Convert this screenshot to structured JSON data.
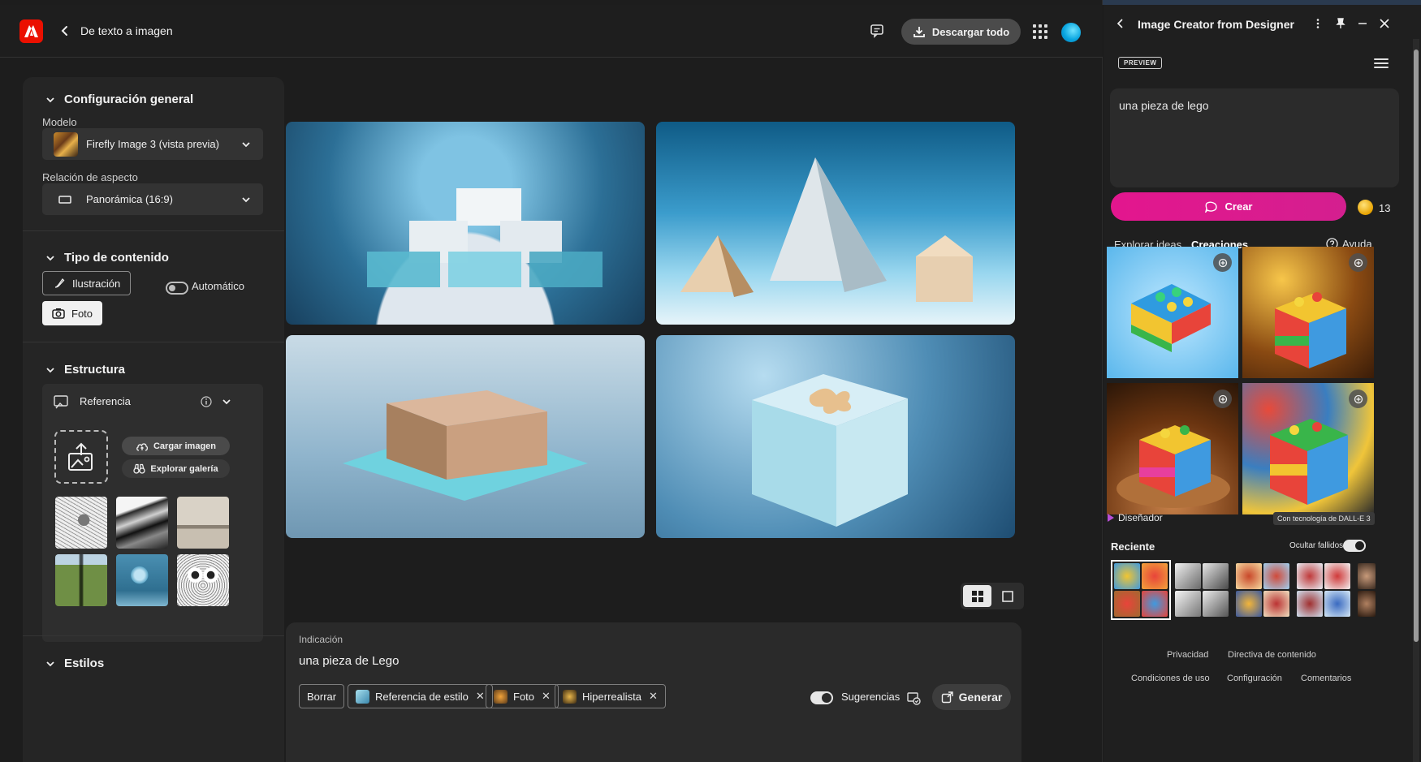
{
  "header": {
    "title": "De texto a imagen",
    "download_label": "Descargar todo"
  },
  "left_panel": {
    "general": {
      "title": "Configuración general",
      "model_label": "Modelo",
      "model_value": "Firefly Image 3 (vista previa)",
      "aspect_label": "Relación de aspecto",
      "aspect_value": "Panorámica (16:9)"
    },
    "content_type": {
      "title": "Tipo de contenido",
      "options": [
        "Ilustración",
        "Foto"
      ],
      "selected": "Foto",
      "auto_label": "Automático"
    },
    "structure": {
      "title": "Estructura",
      "reference_label": "Referencia",
      "upload_label": "Cargar imagen",
      "gallery_label": "Explorar galería"
    },
    "styles": {
      "title": "Estilos"
    }
  },
  "prompt": {
    "label": "Indicación",
    "text": "una pieza de Lego",
    "clear_label": "Borrar",
    "tags": [
      "Referencia de estilo",
      "Foto",
      "Hiperrealista"
    ],
    "suggestions_label": "Sugerencias",
    "generate_label": "Generar"
  },
  "side_panel": {
    "title": "Image Creator from Designer",
    "badge": "PREVIEW",
    "prompt_text": "una pieza de lego",
    "create_label": "Crear",
    "coins": "13",
    "tabs": [
      "Explorar ideas",
      "Creaciones"
    ],
    "active_tab": "Creaciones",
    "help_label": "Ayuda",
    "designer_label": "Diseñador",
    "dalle_label": "Con tecnología de DALL-E 3",
    "recent_label": "Reciente",
    "hide_failed_label": "Ocultar fallidos",
    "footer": [
      "Privacidad",
      "Directiva de contenido",
      "Condiciones de uso",
      "Configuración",
      "Comentarios"
    ]
  },
  "colors": {
    "accent_pink": "#e3168e",
    "adobe_red": "#eb1000",
    "background": "#1d1d1d"
  }
}
